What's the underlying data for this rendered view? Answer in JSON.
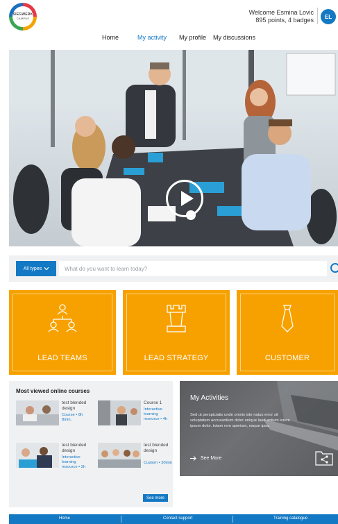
{
  "header": {
    "logo": {
      "line1": "SIEGWERK",
      "line2": "CAMPUS"
    },
    "welcome": "Welcome Esmina Lovic",
    "points": "895 points, 4 badges",
    "avatar_initials": "EL"
  },
  "nav": {
    "items": [
      {
        "label": "Home"
      },
      {
        "label": "My activity",
        "active": true
      },
      {
        "label": "My profile"
      },
      {
        "label": "My discussions"
      }
    ]
  },
  "hero": {
    "icon": "play-icon"
  },
  "search": {
    "type_label": "All types",
    "placeholder": "What do you want to learn today?",
    "icon": "search-icon"
  },
  "tiles": [
    {
      "label": "LEAD TEAMS",
      "icon": "team-hierarchy-icon"
    },
    {
      "label": "LEAD STRATEGY",
      "icon": "chess-rook-icon"
    },
    {
      "label": "CUSTOMER",
      "icon": "tie-icon"
    }
  ],
  "courses": {
    "title": "Most viewed online courses",
    "items": [
      {
        "title": "test blended design",
        "meta": "Course • 8h 8min."
      },
      {
        "title": "Course 1",
        "meta": "Interactive learning resource • 4h"
      },
      {
        "title": "test blended design",
        "meta": "Interactive learning resource • 2h"
      },
      {
        "title": "test blended design",
        "meta": "Custom • 30min"
      }
    ],
    "see_more": "See more"
  },
  "activities": {
    "title": "My Activities",
    "body": "Sed ut perspiciatis unde omnis iste natus error sit voluptatem accusantium dolor enique laud antium lorem ipsum dolor. totam rem aperiam, eaque ipsa.",
    "see_more": "See More"
  },
  "footer": {
    "items": [
      "Home",
      "Contact support",
      "Training catalogue"
    ]
  },
  "colors": {
    "brand_blue": "#1479c4",
    "tile_orange": "#f7a100",
    "panel_grey": "#f0f1f3"
  }
}
